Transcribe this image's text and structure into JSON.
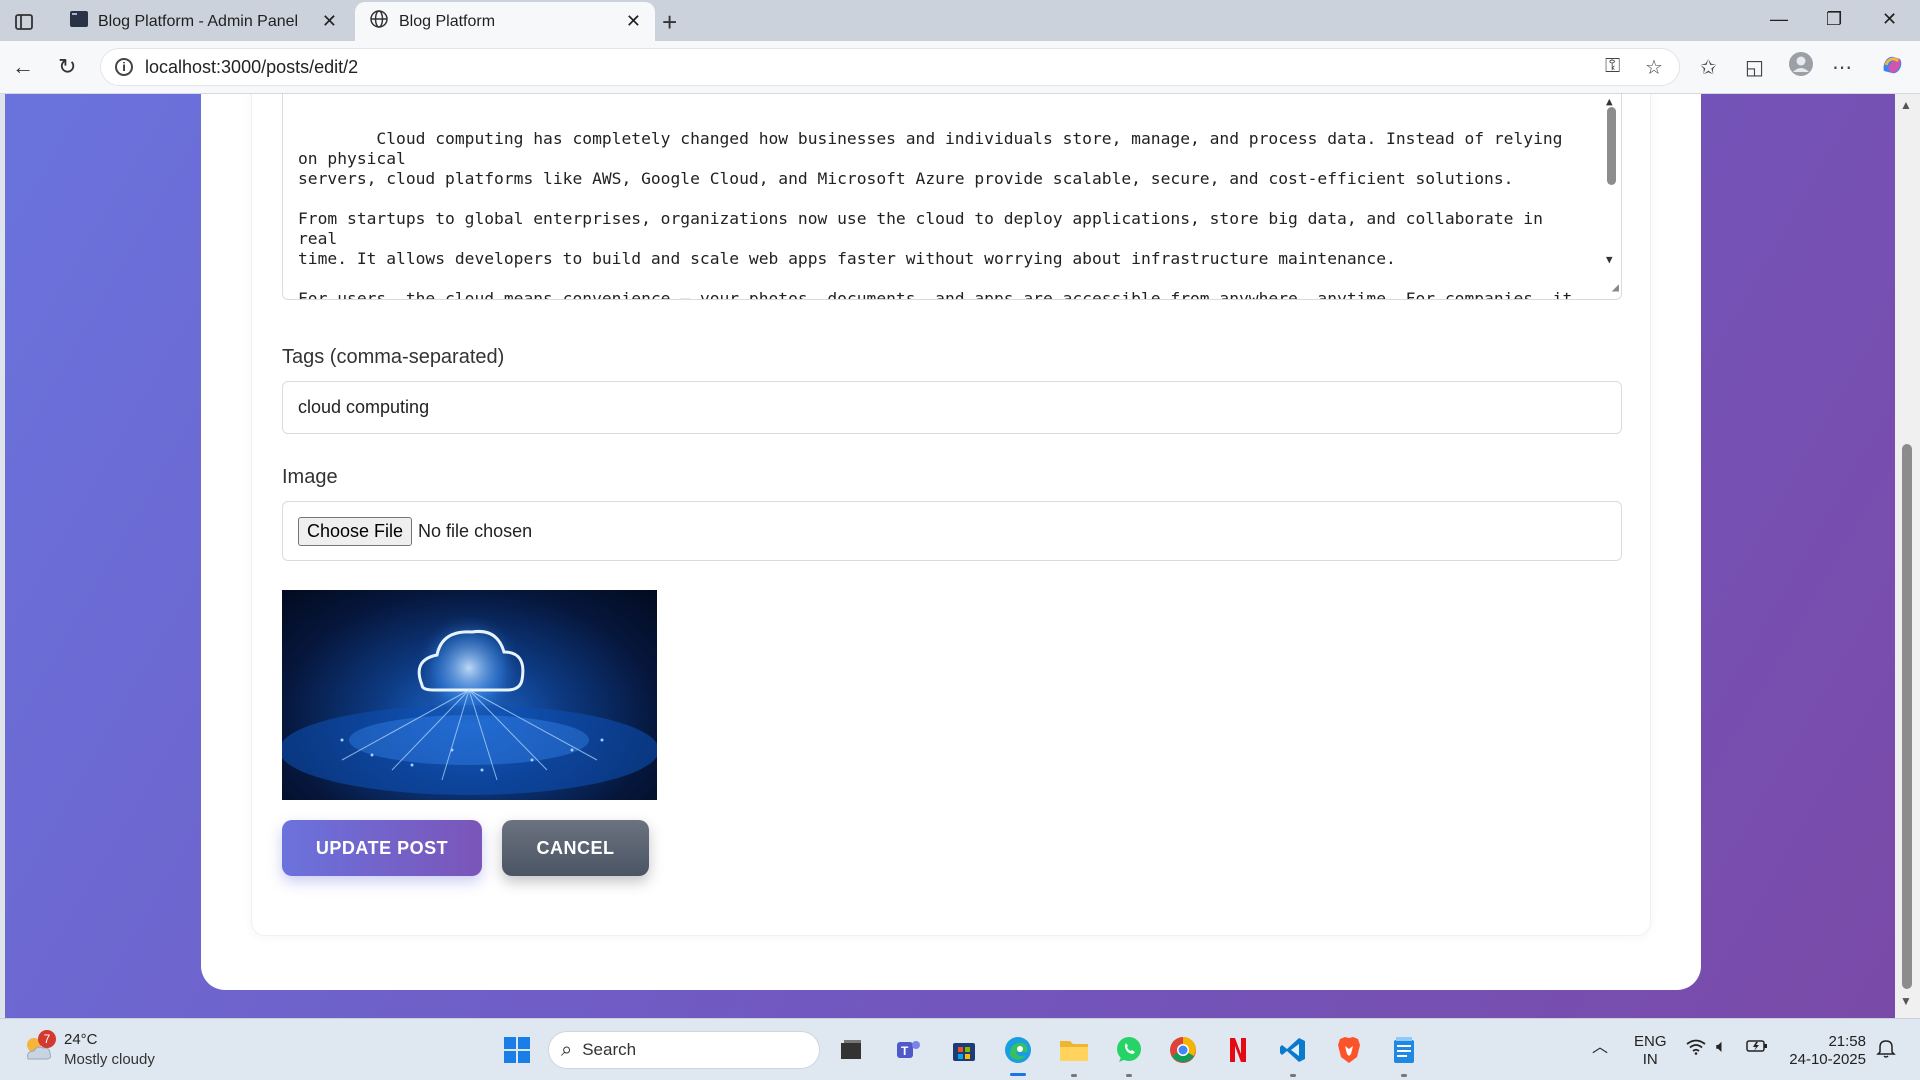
{
  "browser": {
    "tabs": [
      {
        "title": "Blog Platform - Admin Panel",
        "icon": "terminal-icon",
        "active": false
      },
      {
        "title": "Blog Platform",
        "icon": "globe-icon",
        "active": true
      }
    ],
    "url": "localhost:3000/posts/edit/2"
  },
  "form": {
    "content_text": "Cloud computing has completely changed how businesses and individuals store, manage, and process data. Instead of relying on physical\nservers, cloud platforms like AWS, Google Cloud, and Microsoft Azure provide scalable, secure, and cost-efficient solutions.\n\nFrom startups to global enterprises, organizations now use the cloud to deploy applications, store big data, and collaborate in real\ntime. It allows developers to build and scale web apps faster without worrying about infrastructure maintenance.\n\nFor users, the cloud means convenience — your photos, documents, and apps are accessible from anywhere, anytime. For companies, it\nmeans flexibility and innovation at reduced costs.",
    "tags_label": "Tags (comma-separated)",
    "tags_value": "cloud computing",
    "image_label": "Image",
    "file_button": "Choose File",
    "file_status": "No file chosen",
    "update_button": "UPDATE POST",
    "cancel_button": "CANCEL"
  },
  "taskbar": {
    "weather_badge": "7",
    "temperature": "24°C",
    "condition": "Mostly cloudy",
    "search_placeholder": "Search",
    "language": "ENG",
    "region": "IN",
    "time": "21:58",
    "date": "24-10-2025"
  }
}
